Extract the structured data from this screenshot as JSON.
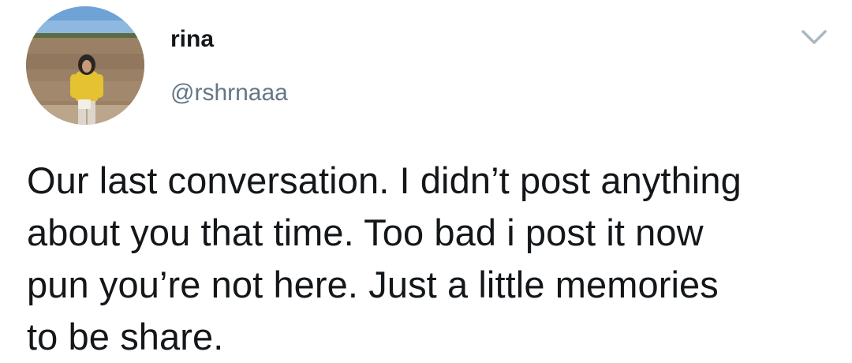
{
  "tweet": {
    "display_name": "rina",
    "handle": "@rshrnaaa",
    "text": "Our last conversation. I didn’t post anything\nabout you that time. Too bad i post it now\npun you’re not here. Just a little memories\nto be share."
  },
  "icons": {
    "avatar": "profile-photo",
    "menu": "chevron-down-icon"
  },
  "colors": {
    "name": "#14171a",
    "handle": "#657786",
    "text": "#14171a",
    "caret": "#aab8c2"
  }
}
